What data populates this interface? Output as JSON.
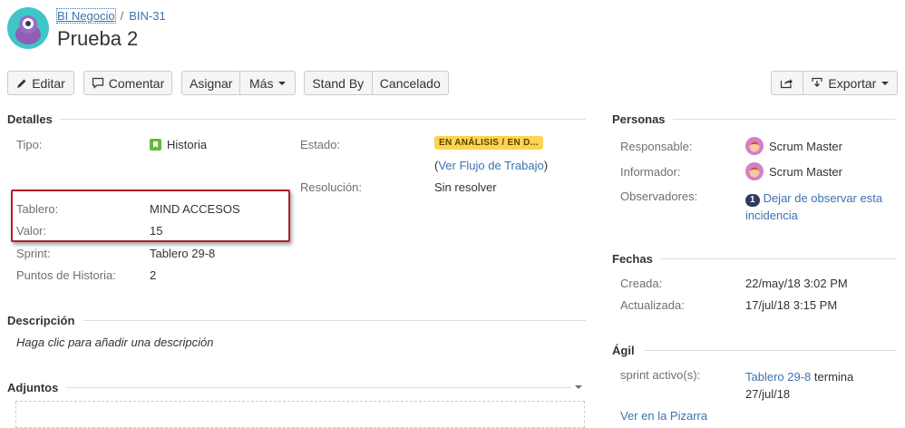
{
  "header": {
    "breadcrumb_project": "BI Negocio",
    "breadcrumb_separator": "/",
    "breadcrumb_issue": "BIN-31",
    "title": "Prueba 2"
  },
  "toolbar": {
    "edit": "Editar",
    "comment": "Comentar",
    "assign": "Asignar",
    "more": "Más",
    "standby": "Stand By",
    "cancelled": "Cancelado",
    "export": "Exportar"
  },
  "details": {
    "heading": "Detalles",
    "tipo_label": "Tipo:",
    "tipo_value": "Historia",
    "estado_label": "Estado:",
    "estado_value": "EN ANÁLISIS / EN D...",
    "workflow_open": "(",
    "workflow_link": "Ver Flujo de Trabajo",
    "workflow_close": ")",
    "resolucion_label": "Resolución:",
    "resolucion_value": "Sin resolver",
    "tablero_label": "Tablero:",
    "tablero_value": "MIND ACCESOS",
    "valor_label": "Valor:",
    "valor_value": "15",
    "sprint_label": "Sprint:",
    "sprint_value": "Tablero 29-8",
    "puntos_label": "Puntos de Historia:",
    "puntos_value": "2"
  },
  "description": {
    "heading": "Descripción",
    "placeholder": "Haga clic para añadir una descripción"
  },
  "attachments": {
    "heading": "Adjuntos"
  },
  "people": {
    "heading": "Personas",
    "responsable_label": "Responsable:",
    "responsable_value": "Scrum Master",
    "informador_label": "Informador:",
    "informador_value": "Scrum Master",
    "observadores_label": "Observadores:",
    "observadores_count": "1",
    "observadores_link_1": "Dejar de observar esta",
    "observadores_link_2": "incidencia"
  },
  "dates": {
    "heading": "Fechas",
    "creada_label": "Creada:",
    "creada_value": "22/may/18 3:02 PM",
    "actualizada_label": "Actualizada:",
    "actualizada_value": "17/jul/18 3:15 PM"
  },
  "agile": {
    "heading": "Ágil",
    "sprint_label": "sprint activo(s):",
    "sprint_link": "Tablero 29-8",
    "sprint_text": "termina",
    "sprint_date": "27/jul/18",
    "board_link": "Ver en la Pizarra"
  },
  "colors": {
    "link": "#3b73af",
    "status_bg": "#ffd351",
    "highlight": "#b01e24"
  },
  "icons": [
    "project-avatar-icon",
    "pencil-icon",
    "comment-icon",
    "share-icon",
    "export-icon",
    "story-icon",
    "user-avatar-icon",
    "collapse-chevron-icon"
  ]
}
